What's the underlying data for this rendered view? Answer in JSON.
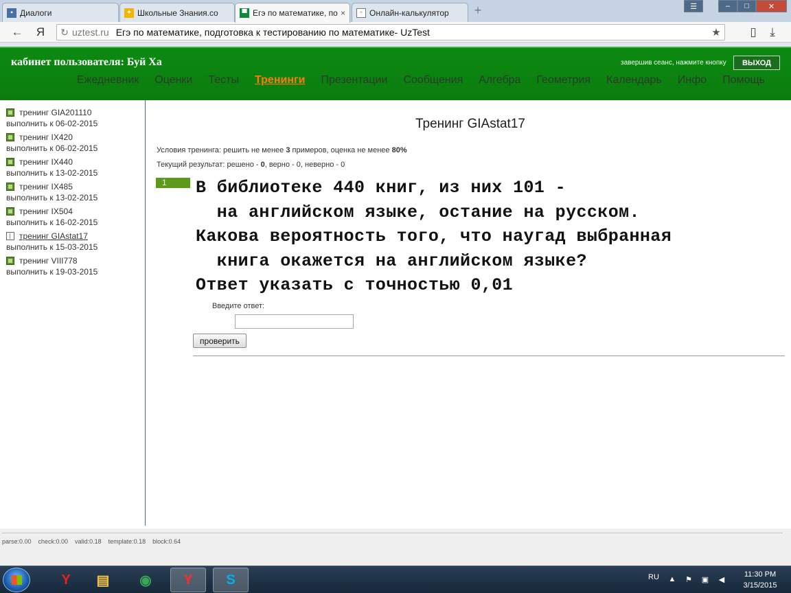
{
  "browser": {
    "tabs": [
      {
        "title": "Диалоги",
        "icon": "chat-icon",
        "color": "#4a6fa5"
      },
      {
        "title": "Школьные Знания.co",
        "icon": "znanija-icon",
        "color": "#f2b600"
      },
      {
        "title": "Егэ по математике, по",
        "icon": "uztest-icon",
        "color": "#0f8a3c"
      },
      {
        "title": "Онлайн-калькулятор",
        "icon": "page-icon",
        "color": "#777777"
      }
    ],
    "close_glyph": "×",
    "newtab_glyph": "+",
    "window_controls": {
      "menu": "☰",
      "minimize": "–",
      "maximize": "□",
      "close": "✕"
    },
    "back_glyph": "←",
    "yandex_glyph": "Я",
    "reload_glyph": "↻",
    "star_glyph": "★",
    "page_glyph": "▯",
    "download_glyph": "⤓",
    "url_host": "uztest.ru",
    "page_title": "Егэ по математике, подготовка к тестированию по математике- UzTest"
  },
  "header": {
    "cabinet": "кабинет пользователя: Буй Ха",
    "logout_hint": "завершив сеанс, нажмите кнопку",
    "logout_button": "ВЫХОД",
    "menu": [
      {
        "label": "Ежедневник",
        "active": false
      },
      {
        "label": "Оценки",
        "active": false
      },
      {
        "label": "Тесты",
        "active": false
      },
      {
        "label": "Тренинги",
        "active": true
      },
      {
        "label": "Презентации",
        "active": false
      },
      {
        "label": "Сообщения",
        "active": false
      },
      {
        "label": "Алгебра",
        "active": false
      },
      {
        "label": "Геометрия",
        "active": false
      },
      {
        "label": "Календарь",
        "active": false
      },
      {
        "label": "Инфо",
        "active": false
      },
      {
        "label": "Помощь",
        "active": false
      }
    ],
    "accent_color": "#ff7a00"
  },
  "sidebar": {
    "items": [
      {
        "label": "тренинг GIA201110",
        "due": "выполнить к 06-02-2015",
        "current": false
      },
      {
        "label": "тренинг IX420",
        "due": "выполнить к 06-02-2015",
        "current": false
      },
      {
        "label": "тренинг IX440",
        "due": "выполнить к 13-02-2015",
        "current": false
      },
      {
        "label": "тренинг IX485",
        "due": "выполнить к 13-02-2015",
        "current": false
      },
      {
        "label": "тренинг IX504",
        "due": "выполнить к 16-02-2015",
        "current": false
      },
      {
        "label": "тренинг GIAstat17",
        "due": "выполнить к 15-03-2015",
        "current": true
      },
      {
        "label": "тренинг VIII778",
        "due": "выполнить к 19-03-2015",
        "current": false
      }
    ]
  },
  "main": {
    "title": "Тренинг GIAstat17",
    "conditions_prefix": "Условия тренинга: решить не менее ",
    "conditions_count": "3",
    "conditions_mid": " примеров, оценка не менее ",
    "conditions_grade": "80%",
    "result_prefix": "Текущий результат: решено - ",
    "result_solved": "0",
    "result_rest": ", верно - 0, неверно - 0",
    "question_number": "1",
    "question_lines": [
      "В библиотеке 440 книг, из них 101 -",
      "  на английском языке, остание на русском.",
      "Какова вероятность того, что наугад выбранная",
      "  книга окажется на английском языке?",
      "Ответ указать с точностью 0,01"
    ],
    "answer_label": "Введите ответ:",
    "answer_value": "",
    "check_button": "проверить"
  },
  "footer": {
    "stats": "parse:0.00    check:0.00    valid:0.18    template:0.18    block:0.64"
  },
  "taskbar": {
    "apps": [
      {
        "name": "yandex-browser-icon",
        "glyph": "Y",
        "color": "#e8211d"
      },
      {
        "name": "file-explorer-icon",
        "glyph": "▤",
        "color": "#f5c542"
      },
      {
        "name": "chrome-icon",
        "glyph": "◉",
        "color": "#3aa757"
      },
      {
        "name": "yandex-icon",
        "glyph": "Y",
        "color": "#ff2b2b"
      },
      {
        "name": "skype-icon",
        "glyph": "S",
        "color": "#00aff0"
      }
    ],
    "lang": "RU",
    "time": "11:30 PM",
    "date": "3/15/2015"
  }
}
